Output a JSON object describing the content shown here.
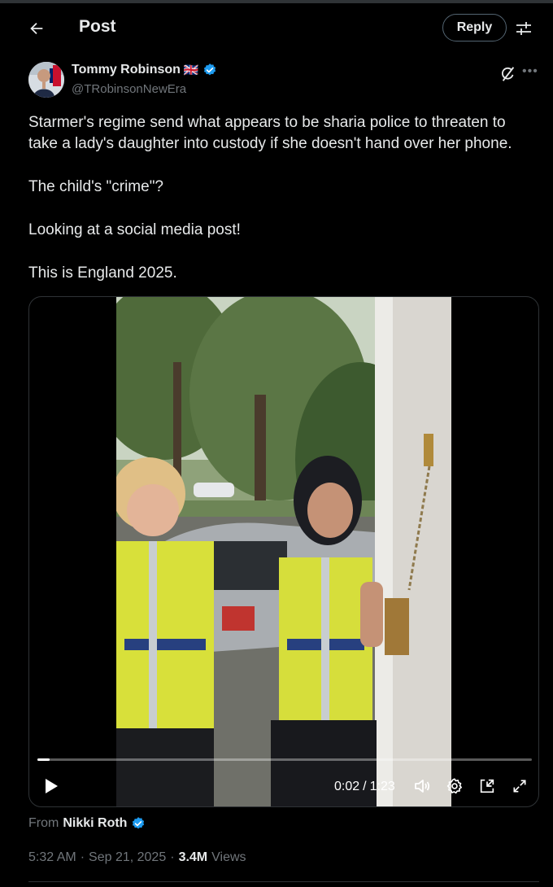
{
  "header": {
    "title": "Post",
    "reply_label": "Reply"
  },
  "author": {
    "name": "Tommy Robinson",
    "flag": "🇬🇧",
    "handle": "@TRobinsonNewEra"
  },
  "tweet": {
    "paragraphs": [
      "Starmer's regime send what appears to be sharia police to threaten to take a lady's daughter into custody if she doesn't hand over her phone.",
      "The child's \"crime\"?",
      "Looking at a social media post!",
      "This is England 2025."
    ]
  },
  "video": {
    "current_time": "0:02",
    "separator": "/",
    "duration": "1:23",
    "progress_fraction": 0.025
  },
  "attribution": {
    "prefix": "From",
    "name": "Nikki Roth"
  },
  "meta": {
    "time": "5:32 AM",
    "dot1": "·",
    "date": "Sep 21, 2025",
    "dot2": "·",
    "views_count": "3.4M",
    "views_label": "Views"
  },
  "colors": {
    "accent": "#1d9bf0",
    "muted": "#71767b",
    "text": "#e7e9ea",
    "border": "#2f3336"
  }
}
